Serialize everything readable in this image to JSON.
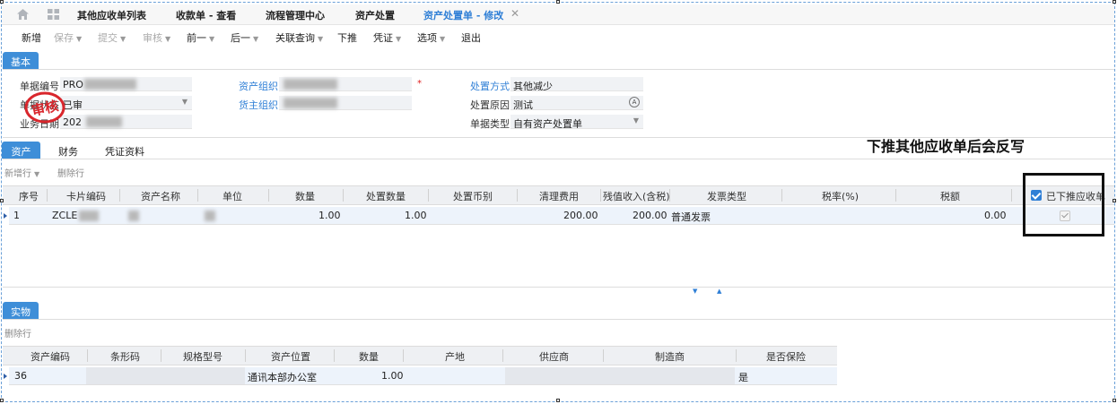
{
  "tabs": [
    {
      "label": "其他应收单列表"
    },
    {
      "label": "收款单 - 查看"
    },
    {
      "label": "流程管理中心"
    },
    {
      "label": "资产处置"
    },
    {
      "label": "资产处置单 - 修改"
    }
  ],
  "toolbar": {
    "new": "新增",
    "save": "保存",
    "submit": "提交",
    "audit": "审核",
    "prev": "前一",
    "next": "后一",
    "link_query": "关联查询",
    "push": "下推",
    "voucher": "凭证",
    "options": "选项",
    "exit": "退出"
  },
  "sections": {
    "basic": "基本",
    "physical": "实物"
  },
  "form": {
    "doc_no_label": "单据编号",
    "doc_no_value": "PRO",
    "doc_status_label": "单据状态",
    "doc_status_value": "已审",
    "biz_date_label": "业务日期",
    "biz_date_value": "202",
    "asset_org_label": "资产组织",
    "owner_org_label": "货主组织",
    "dispose_method_label": "处置方式",
    "dispose_method_value": "其他减少",
    "dispose_reason_label": "处置原因",
    "dispose_reason_value": "测试",
    "doc_type_label": "单据类型",
    "doc_type_value": "自有资产处置单",
    "required_mark": "*",
    "stamp_text": "审核"
  },
  "subtabs": {
    "asset": "资产",
    "finance": "财务",
    "voucher_data": "凭证资料"
  },
  "asset_grid": {
    "tools": {
      "new_row": "新增行",
      "delete_row": "删除行"
    },
    "columns": [
      "序号",
      "卡片编码",
      "资产名称",
      "单位",
      "数量",
      "处置数量",
      "处置币别",
      "清理费用",
      "残值收入(含税)",
      "发票类型",
      "税率(%)",
      "税额",
      "已下推应收单"
    ],
    "row": {
      "seq": "1",
      "card_code": "ZCLE",
      "asset_name": "",
      "unit": "",
      "qty": "1.00",
      "dispose_qty": "1.00",
      "currency": "",
      "cleanup_fee": "200.00",
      "salvage_income": "200.00",
      "invoice_type": "普通发票",
      "tax_rate": "",
      "tax_amount": "0.00",
      "pushed": true
    }
  },
  "physical_grid": {
    "tools": {
      "delete_row": "删除行"
    },
    "columns": [
      "资产编码",
      "条形码",
      "规格型号",
      "资产位置",
      "数量",
      "产地",
      "供应商",
      "制造商",
      "是否保险"
    ],
    "row": {
      "asset_code": "36",
      "barcode": "",
      "spec": "",
      "location": "通讯本部办公室",
      "qty": "1.00",
      "origin": "",
      "supplier": "",
      "maker": "",
      "insured": "是"
    }
  },
  "annotation": {
    "text": "下推其他应收单后会反写"
  },
  "colors": {
    "accent": "#2f7fd6",
    "section_tag": "#3e8ed8",
    "stamp_red": "#d9262c"
  }
}
